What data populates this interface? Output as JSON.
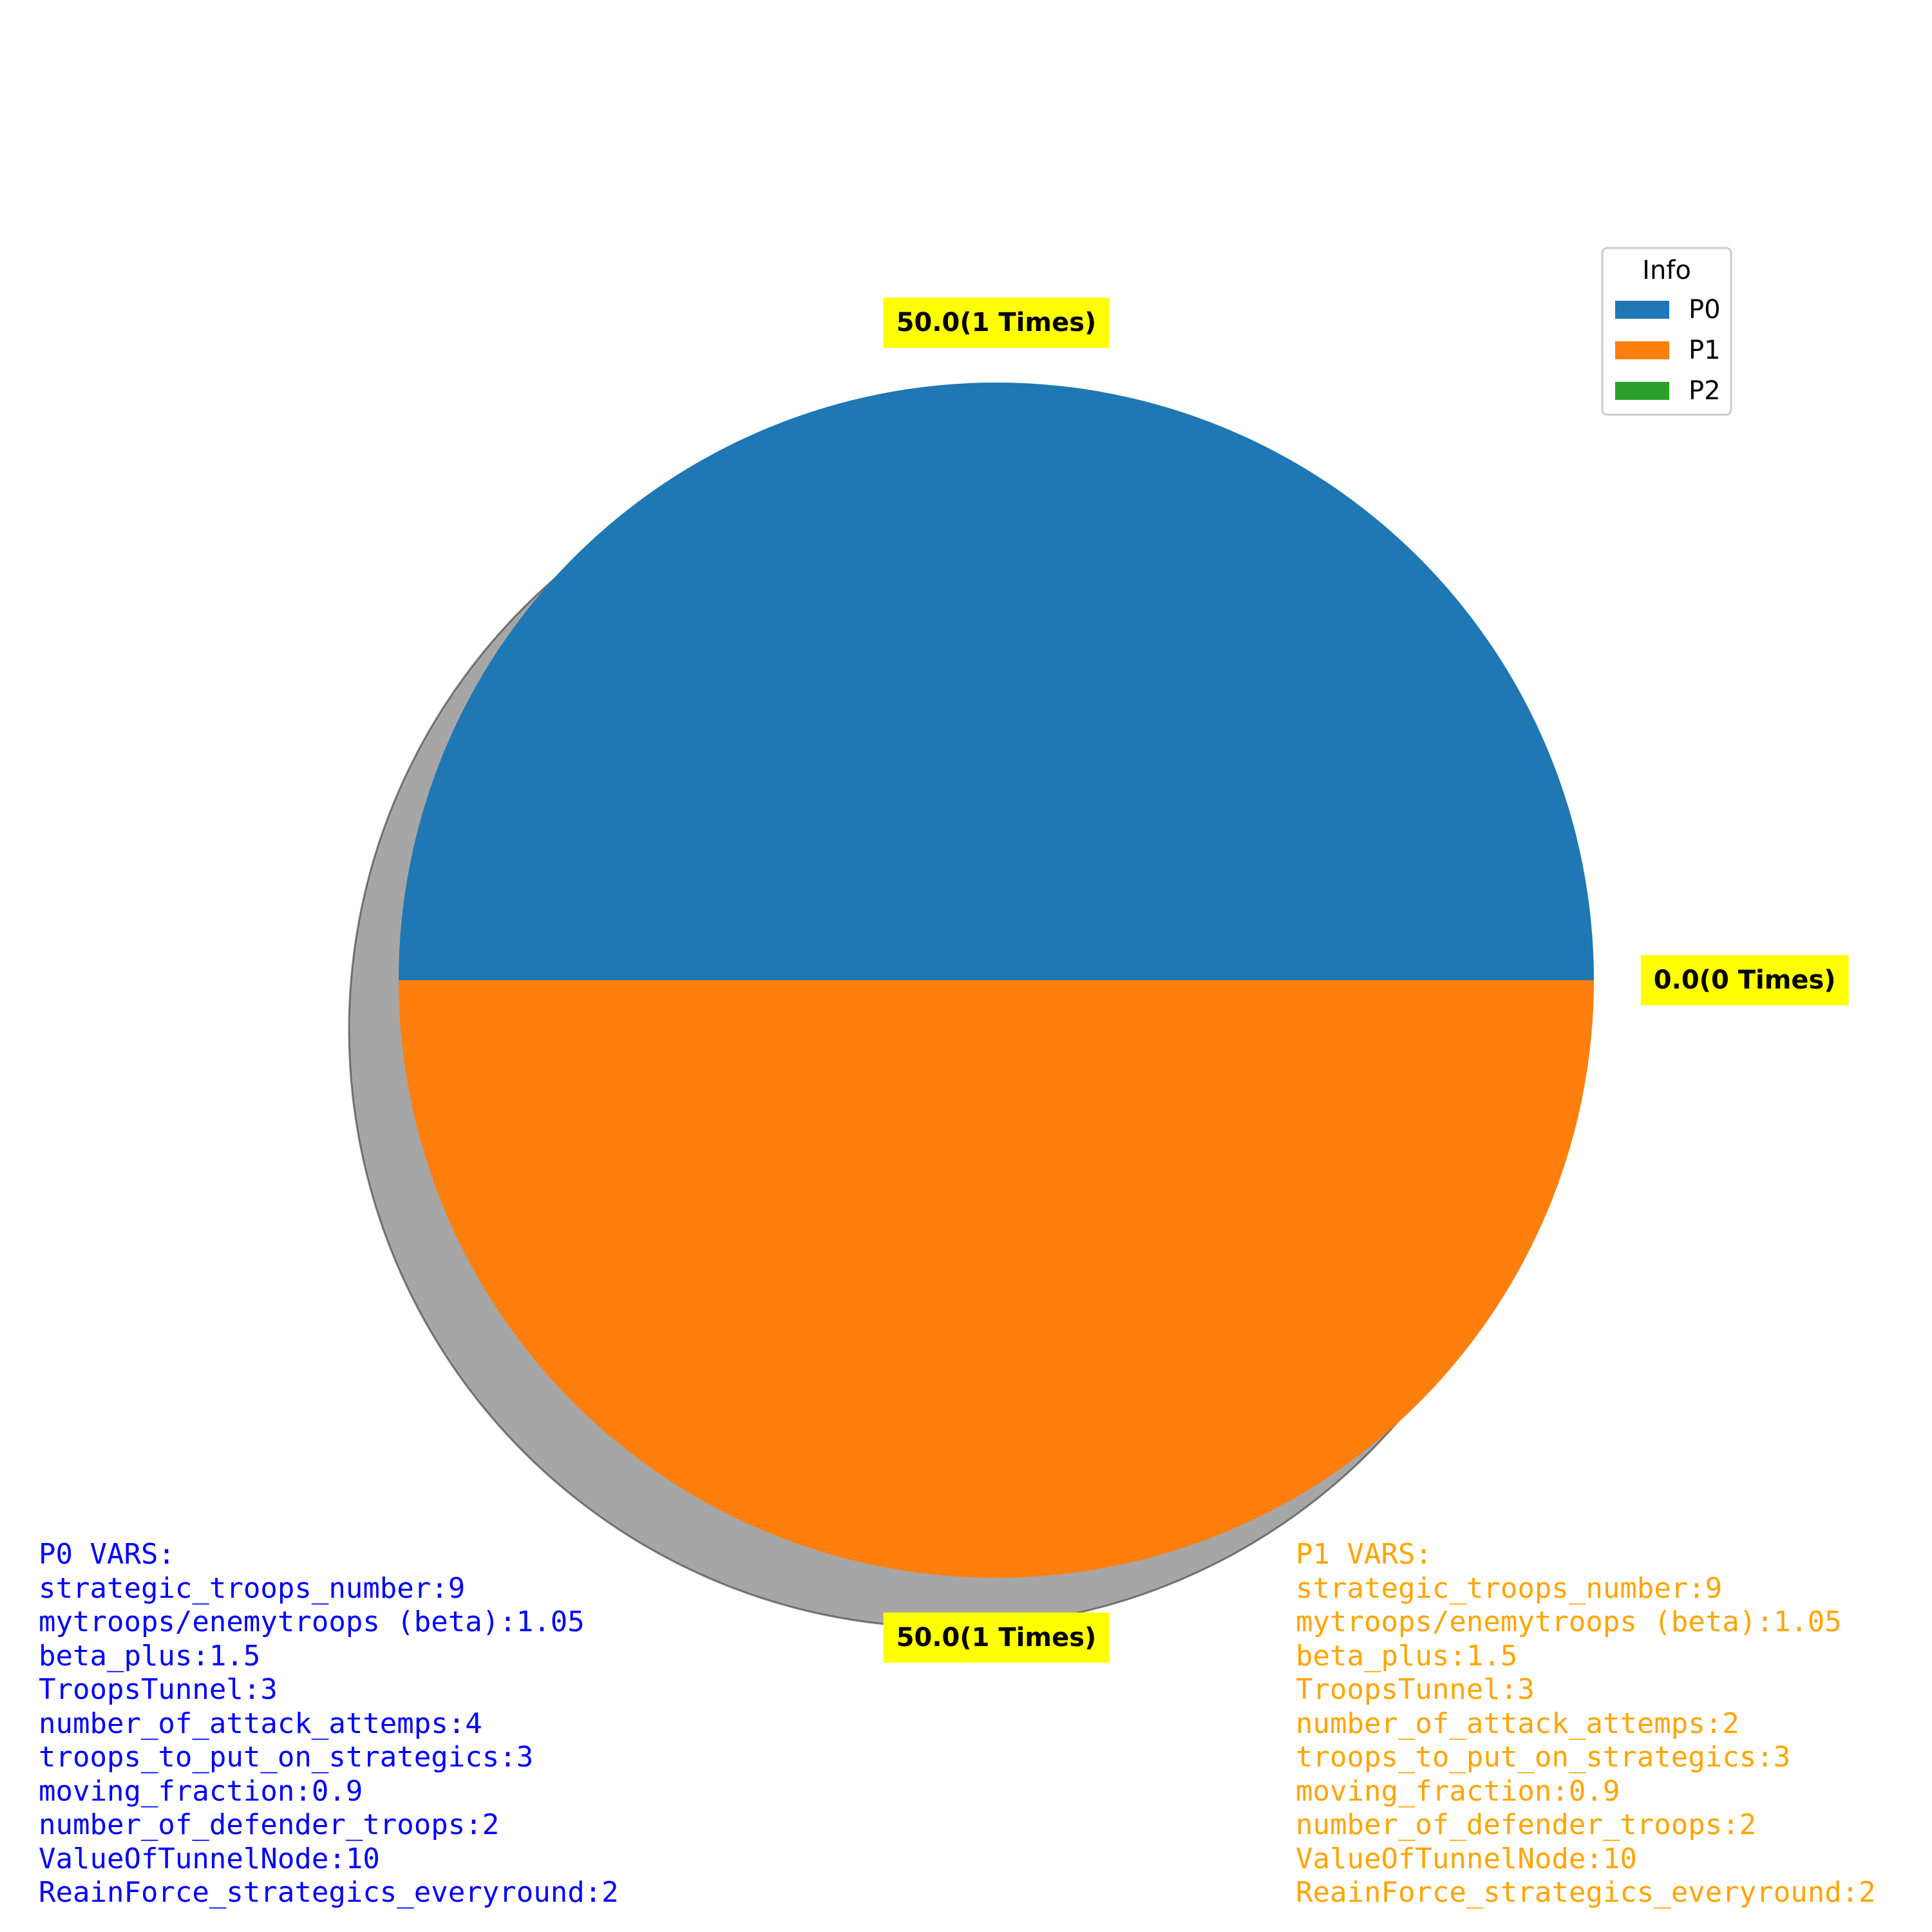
{
  "chart_data": {
    "type": "pie",
    "legend": {
      "title": "Info",
      "position": "top-right",
      "entries": [
        {
          "label": "P0",
          "color": "#1f77b4"
        },
        {
          "label": "P1",
          "color": "#ff7f0e"
        },
        {
          "label": "P2",
          "color": "#2ca02c"
        }
      ]
    },
    "slices": [
      {
        "name": "P0",
        "value": 50.0,
        "label": "50.0(1 Times)",
        "color": "#1f77b4"
      },
      {
        "name": "P1",
        "value": 50.0,
        "label": "50.0(1 Times)",
        "color": "#ff7f0e"
      },
      {
        "name": "P2",
        "value": 0.0,
        "label": "0.0(0 Times)",
        "color": "#2ca02c"
      }
    ],
    "shadow": true,
    "label_style": {
      "background": "#ffff00",
      "text_color": "#000000",
      "weight": "bold"
    }
  },
  "vars": {
    "p0": {
      "color": "#0000ff",
      "lines": [
        "P0 VARS:",
        "strategic_troops_number:9",
        "mytroops/enemytroops (beta):1.05",
        "beta_plus:1.5",
        "TroopsTunnel:3",
        "number_of_attack_attemps:4",
        "troops_to_put_on_strategics:3",
        "moving_fraction:0.9",
        "number_of_defender_troops:2",
        "ValueOfTunnelNode:10",
        "ReainForce_strategics_everyround:2"
      ]
    },
    "p1": {
      "color": "#ffa500",
      "lines": [
        "P1 VARS:",
        "strategic_troops_number:9",
        "mytroops/enemytroops (beta):1.05",
        "beta_plus:1.5",
        "TroopsTunnel:3",
        "number_of_attack_attemps:2",
        "troops_to_put_on_strategics:3",
        "moving_fraction:0.9",
        "number_of_defender_troops:2",
        "ValueOfTunnelNode:10",
        "ReainForce_strategics_everyround:2"
      ]
    }
  }
}
